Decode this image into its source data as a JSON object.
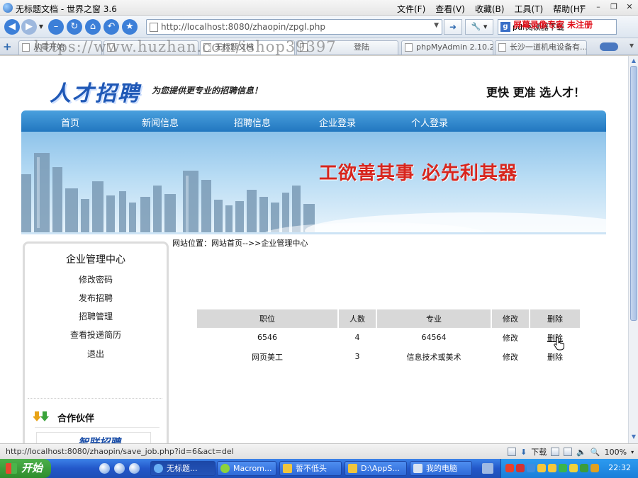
{
  "browser": {
    "window_title": "无标题文档 - 世界之窗 3.6",
    "menu": [
      "文件(F)",
      "查看(V)",
      "收藏(B)",
      "工具(T)",
      "帮助(H)"
    ],
    "url": "http://localhost:8080/zhaopin/zpgl.php",
    "search_value": "pdf阅读器下载",
    "tabs": [
      "从零开始",
      "无标题文档",
      "登陆",
      "phpMyAdmin 2.10.2...",
      "长沙一道机电设备有..."
    ],
    "recorder_watermark": "屏幕录像专家  未注册",
    "site_watermark": "https://www.huzhan.com/ishop39397",
    "status_url": "http://localhost:8080/zhaopin/save_job.php?id=6&act=del",
    "download_label": "下载",
    "zoom": "100%"
  },
  "site": {
    "logo_text": "人才招聘",
    "slogan": "为您提供更专业的招聘信息！",
    "tagline": "更快 更准 选人才！",
    "nav": [
      "首页",
      "新闻信息",
      "招聘信息",
      "企业登录",
      "个人登录"
    ],
    "banner_text": "工欲善其事  必先利其器",
    "breadcrumb": "网站位置：网站首页-->>企业管理中心"
  },
  "sidebar": {
    "title": "企业管理中心",
    "items": [
      "修改密码",
      "发布招聘",
      "招聘管理",
      "查看投递简历",
      "退出"
    ],
    "partner_title": "合作伙伴",
    "partner_logo": "智联招聘"
  },
  "jobs": {
    "headers": [
      "职位",
      "人数",
      "专业",
      "修改",
      "删除"
    ],
    "rows": [
      {
        "title": "6546",
        "count": "4",
        "major": "64564",
        "edit": "修改",
        "del": "删除"
      },
      {
        "title": "网页美工",
        "count": "3",
        "major": "信息技术或美术",
        "edit": "修改",
        "del": "删除"
      }
    ]
  },
  "taskbar": {
    "start": "开始",
    "tasks": [
      "无标题...",
      "Macrom...",
      "誓不低头",
      "D:\\AppS...",
      "我的电脑"
    ],
    "time": "22:32"
  }
}
